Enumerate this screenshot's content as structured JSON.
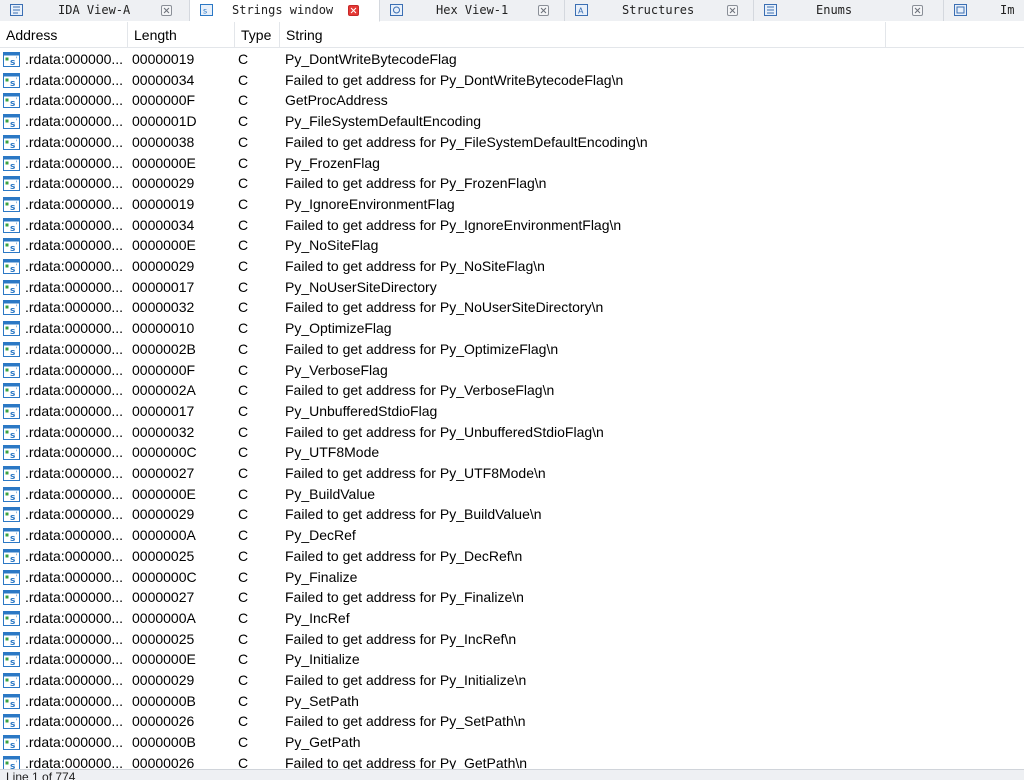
{
  "tabs": [
    {
      "label": "IDA View-A",
      "icon": "ida-view-icon",
      "active": false
    },
    {
      "label": "Strings window",
      "icon": "strings-window-icon",
      "active": true
    },
    {
      "label": "Hex View-1",
      "icon": "hex-view-icon",
      "active": false
    },
    {
      "label": "Structures",
      "icon": "structures-icon",
      "active": false
    },
    {
      "label": "Enums",
      "icon": "enums-icon",
      "active": false
    },
    {
      "label": "Im",
      "icon": "imports-icon",
      "active": false
    }
  ],
  "columns": {
    "address": "Address",
    "length": "Length",
    "type": "Type",
    "string": "String"
  },
  "rows": [
    {
      "address": ".rdata:000000...",
      "length": "00000019",
      "type": "C",
      "string": "Py_DontWriteBytecodeFlag"
    },
    {
      "address": ".rdata:000000...",
      "length": "00000034",
      "type": "C",
      "string": "Failed to get address for Py_DontWriteBytecodeFlag\\n"
    },
    {
      "address": ".rdata:000000...",
      "length": "0000000F",
      "type": "C",
      "string": "GetProcAddress"
    },
    {
      "address": ".rdata:000000...",
      "length": "0000001D",
      "type": "C",
      "string": "Py_FileSystemDefaultEncoding"
    },
    {
      "address": ".rdata:000000...",
      "length": "00000038",
      "type": "C",
      "string": "Failed to get address for Py_FileSystemDefaultEncoding\\n"
    },
    {
      "address": ".rdata:000000...",
      "length": "0000000E",
      "type": "C",
      "string": "Py_FrozenFlag"
    },
    {
      "address": ".rdata:000000...",
      "length": "00000029",
      "type": "C",
      "string": "Failed to get address for Py_FrozenFlag\\n"
    },
    {
      "address": ".rdata:000000...",
      "length": "00000019",
      "type": "C",
      "string": "Py_IgnoreEnvironmentFlag"
    },
    {
      "address": ".rdata:000000...",
      "length": "00000034",
      "type": "C",
      "string": "Failed to get address for Py_IgnoreEnvironmentFlag\\n"
    },
    {
      "address": ".rdata:000000...",
      "length": "0000000E",
      "type": "C",
      "string": "Py_NoSiteFlag"
    },
    {
      "address": ".rdata:000000...",
      "length": "00000029",
      "type": "C",
      "string": "Failed to get address for Py_NoSiteFlag\\n"
    },
    {
      "address": ".rdata:000000...",
      "length": "00000017",
      "type": "C",
      "string": "Py_NoUserSiteDirectory"
    },
    {
      "address": ".rdata:000000...",
      "length": "00000032",
      "type": "C",
      "string": "Failed to get address for Py_NoUserSiteDirectory\\n"
    },
    {
      "address": ".rdata:000000...",
      "length": "00000010",
      "type": "C",
      "string": "Py_OptimizeFlag"
    },
    {
      "address": ".rdata:000000...",
      "length": "0000002B",
      "type": "C",
      "string": "Failed to get address for Py_OptimizeFlag\\n"
    },
    {
      "address": ".rdata:000000...",
      "length": "0000000F",
      "type": "C",
      "string": "Py_VerboseFlag"
    },
    {
      "address": ".rdata:000000...",
      "length": "0000002A",
      "type": "C",
      "string": "Failed to get address for Py_VerboseFlag\\n"
    },
    {
      "address": ".rdata:000000...",
      "length": "00000017",
      "type": "C",
      "string": "Py_UnbufferedStdioFlag"
    },
    {
      "address": ".rdata:000000...",
      "length": "00000032",
      "type": "C",
      "string": "Failed to get address for Py_UnbufferedStdioFlag\\n"
    },
    {
      "address": ".rdata:000000...",
      "length": "0000000C",
      "type": "C",
      "string": "Py_UTF8Mode"
    },
    {
      "address": ".rdata:000000...",
      "length": "00000027",
      "type": "C",
      "string": "Failed to get address for Py_UTF8Mode\\n"
    },
    {
      "address": ".rdata:000000...",
      "length": "0000000E",
      "type": "C",
      "string": "Py_BuildValue"
    },
    {
      "address": ".rdata:000000...",
      "length": "00000029",
      "type": "C",
      "string": "Failed to get address for Py_BuildValue\\n"
    },
    {
      "address": ".rdata:000000...",
      "length": "0000000A",
      "type": "C",
      "string": "Py_DecRef"
    },
    {
      "address": ".rdata:000000...",
      "length": "00000025",
      "type": "C",
      "string": "Failed to get address for Py_DecRef\\n"
    },
    {
      "address": ".rdata:000000...",
      "length": "0000000C",
      "type": "C",
      "string": "Py_Finalize"
    },
    {
      "address": ".rdata:000000...",
      "length": "00000027",
      "type": "C",
      "string": "Failed to get address for Py_Finalize\\n"
    },
    {
      "address": ".rdata:000000...",
      "length": "0000000A",
      "type": "C",
      "string": "Py_IncRef"
    },
    {
      "address": ".rdata:000000...",
      "length": "00000025",
      "type": "C",
      "string": "Failed to get address for Py_IncRef\\n"
    },
    {
      "address": ".rdata:000000...",
      "length": "0000000E",
      "type": "C",
      "string": "Py_Initialize"
    },
    {
      "address": ".rdata:000000...",
      "length": "00000029",
      "type": "C",
      "string": "Failed to get address for Py_Initialize\\n"
    },
    {
      "address": ".rdata:000000...",
      "length": "0000000B",
      "type": "C",
      "string": "Py_SetPath"
    },
    {
      "address": ".rdata:000000...",
      "length": "00000026",
      "type": "C",
      "string": "Failed to get address for Py_SetPath\\n"
    },
    {
      "address": ".rdata:000000...",
      "length": "0000000B",
      "type": "C",
      "string": "Py_GetPath"
    },
    {
      "address": ".rdata:000000...",
      "length": "00000026",
      "type": "C",
      "string": "Failed to get address for Py_GetPath\\n"
    }
  ],
  "status": {
    "text": "Line 1 of 774"
  },
  "colors": {
    "accent_icon": "#2b78c5",
    "active_close": "#e53935"
  }
}
